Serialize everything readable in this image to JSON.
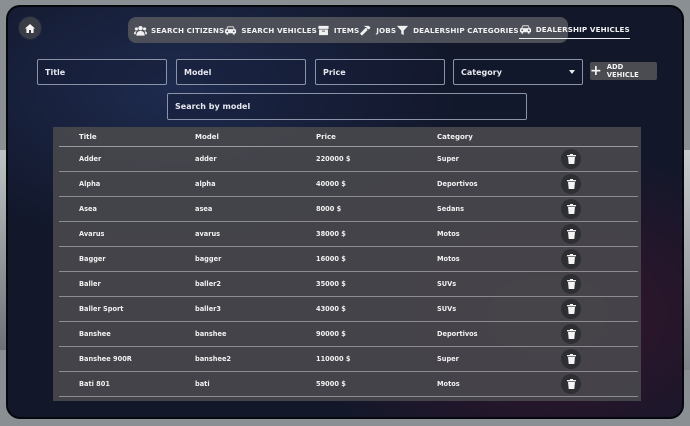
{
  "nav": {
    "items": [
      {
        "label": "Search Citizens",
        "icon": "users-icon"
      },
      {
        "label": "Search Vehicles",
        "icon": "car-icon"
      },
      {
        "label": "Items",
        "icon": "box-icon"
      },
      {
        "label": "Jobs",
        "icon": "hammer-icon"
      },
      {
        "label": "Dealership Categories",
        "icon": "filter-icon"
      },
      {
        "label": "Dealership Vehicles",
        "icon": "car-icon",
        "active": true
      }
    ]
  },
  "form": {
    "title_placeholder": "Title",
    "model_placeholder": "Model",
    "price_placeholder": "Price",
    "category_value": "Category",
    "add_label": "Add Vehicle",
    "search_placeholder": "Search by model"
  },
  "table": {
    "headers": {
      "title": "Title",
      "model": "Model",
      "price": "Price",
      "category": "Category"
    },
    "rows": [
      {
        "title": "Adder",
        "model": "adder",
        "price": "220000 $",
        "category": "Super"
      },
      {
        "title": "Alpha",
        "model": "alpha",
        "price": "40000 $",
        "category": "Deportivos"
      },
      {
        "title": "Asea",
        "model": "asea",
        "price": "8000 $",
        "category": "Sedans"
      },
      {
        "title": "Avarus",
        "model": "avarus",
        "price": "38000 $",
        "category": "Motos"
      },
      {
        "title": "Bagger",
        "model": "bagger",
        "price": "16000 $",
        "category": "Motos"
      },
      {
        "title": "Baller",
        "model": "baller2",
        "price": "35000 $",
        "category": "SUVs"
      },
      {
        "title": "Baller Sport",
        "model": "baller3",
        "price": "43000 $",
        "category": "SUVs"
      },
      {
        "title": "Banshee",
        "model": "banshee",
        "price": "90000 $",
        "category": "Deportivos"
      },
      {
        "title": "Banshee 900R",
        "model": "banshee2",
        "price": "110000 $",
        "category": "Super"
      },
      {
        "title": "Bati 801",
        "model": "bati",
        "price": "59000 $",
        "category": "Motos"
      }
    ]
  },
  "colors": {
    "panel_bg": "#12172a",
    "nav_bg": "#4c4f57",
    "table_bg": "#48484c",
    "text": "#f2f2f2"
  }
}
